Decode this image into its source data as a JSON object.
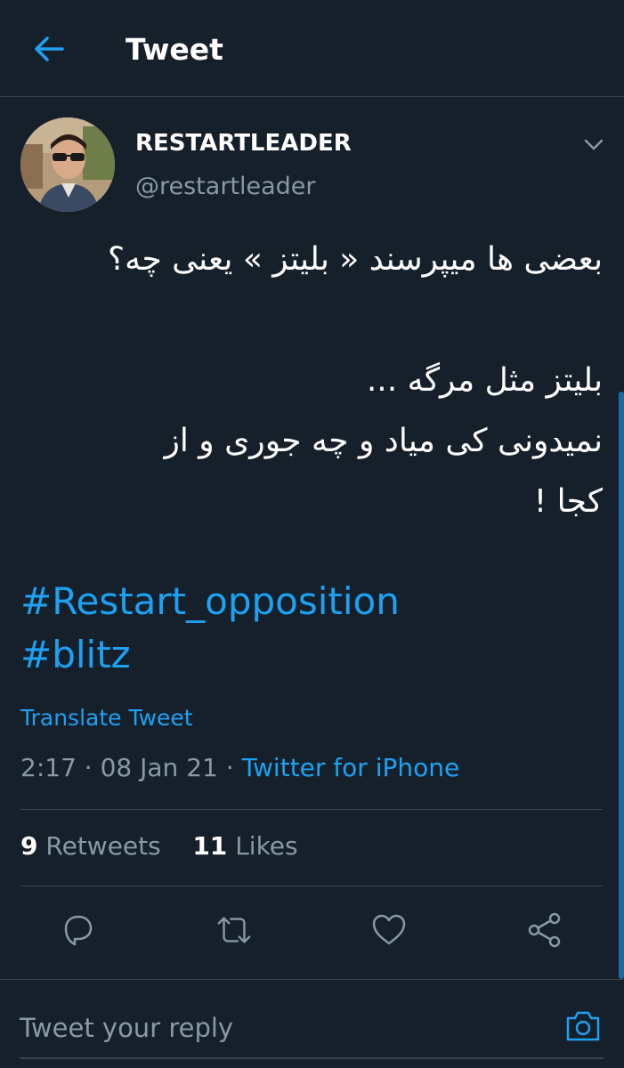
{
  "header": {
    "title": "Tweet",
    "back_icon": "arrow-left-icon"
  },
  "author": {
    "display_name": "RESTARTLEADER",
    "handle": "@restartleader"
  },
  "tweet": {
    "lines": [
      "بعضی ها میپرسند « بلیتز » یعنی چه؟",
      "",
      "بلیتز مثل مرگه ...",
      "نمیدونی کی میاد و چه جوری و از",
      "کجا !"
    ],
    "hashtags": [
      "#Restart_opposition",
      "#blitz"
    ],
    "translate_label": "Translate Tweet",
    "time": "2:17",
    "date": "08 Jan 21",
    "separator": "·",
    "source": "Twitter for iPhone"
  },
  "stats": {
    "retweets_count": "9",
    "retweets_label": "Retweets",
    "likes_count": "11",
    "likes_label": "Likes"
  },
  "actions": {
    "icons": [
      "reply-icon",
      "retweet-icon",
      "like-icon",
      "share-icon"
    ]
  },
  "reply": {
    "placeholder": "Tweet your reply",
    "camera_icon": "camera-icon"
  },
  "colors": {
    "background": "#15202b",
    "accent": "#1da1f2",
    "secondary_text": "#8899a6",
    "divider": "#38444d"
  }
}
